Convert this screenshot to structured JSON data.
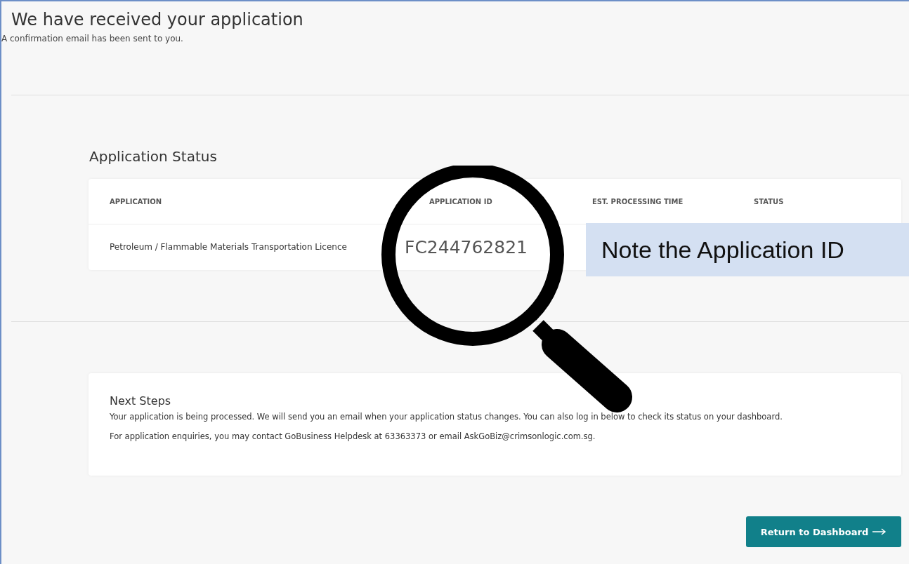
{
  "header": {
    "title": "We have received your application",
    "subtitle": "A confirmation email has been sent to you."
  },
  "status_section": {
    "title": "Application Status",
    "columns": [
      "APPLICATION",
      "APPLICATION ID",
      "EST. PROCESSING TIME",
      "STATUS"
    ],
    "row": {
      "application": "Petroleum / Flammable Materials Transportation Licence",
      "application_id": "FC244762821"
    }
  },
  "next_steps": {
    "title": "Next Steps",
    "paragraphs": [
      "Your application is being processed. We will send you an email when your application status changes. You can also log in below to check its status on your dashboard.",
      "For application enquiries, you may contact GoBusiness Helpdesk at 63363373 or email AskGoBiz@crimsonlogic.com.sg."
    ]
  },
  "button": {
    "label": "Return to Dashboard"
  },
  "callout": {
    "text": "Note the Application ID"
  }
}
